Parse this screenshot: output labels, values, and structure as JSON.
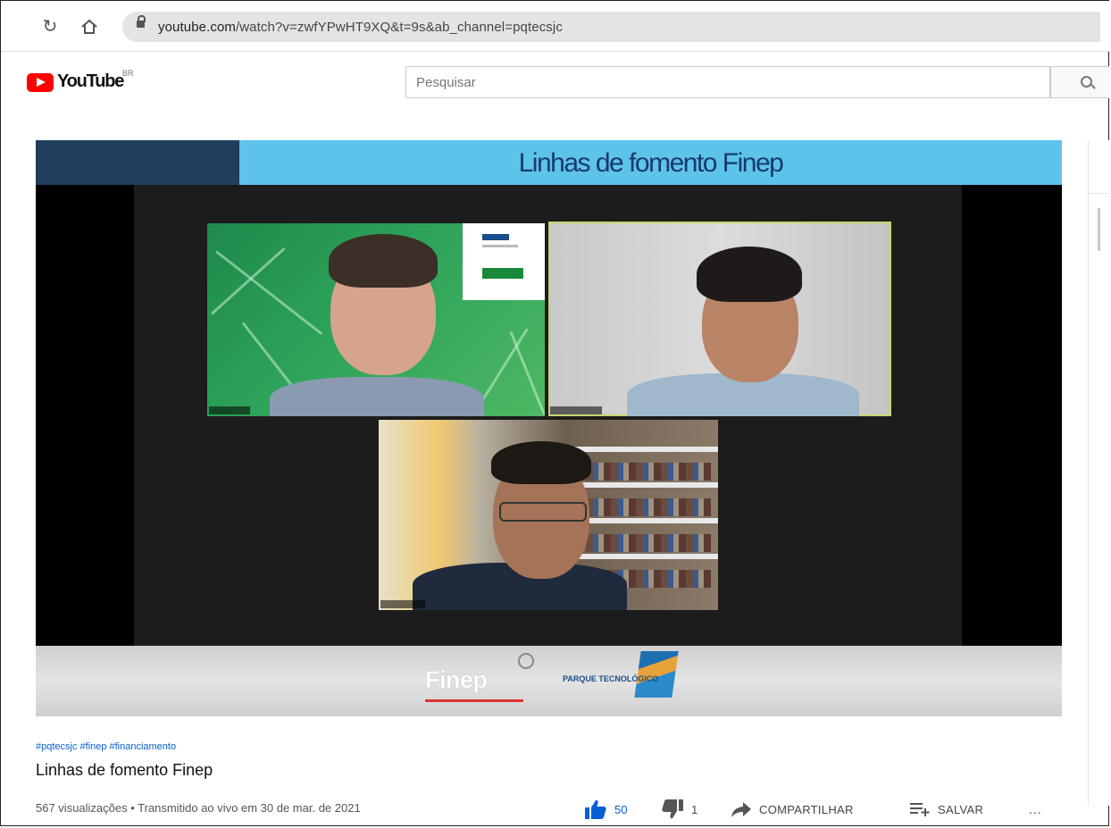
{
  "browser": {
    "url_domain": "youtube.com",
    "url_path": "/watch?v=zwfYPwHT9XQ&t=9s&ab_channel=pqtecsjc"
  },
  "youtube": {
    "logo_text": "YouTube",
    "logo_country": "BR",
    "search_placeholder": "Pesquisar"
  },
  "video_frame": {
    "banner_title": "Linhas de fomento Finep",
    "finep_logo_text": "Finep",
    "parque_logo_text": "PARQUE TECNOLÓGICO"
  },
  "video": {
    "hashtags": [
      "#pqtecsjc",
      "#finep",
      "#financiamento"
    ],
    "title": "Linhas de fomento Finep",
    "meta": "567 visualizações • Transmitido ao vivo em 30 de mar. de 2021",
    "likes": "50",
    "dislikes": "1",
    "share_label": "COMPARTILHAR",
    "save_label": "SALVAR",
    "more_label": "..."
  },
  "colors": {
    "youtube_red": "#ff0000",
    "like_blue": "#065fd4",
    "banner_cyan": "#5ec3ea",
    "banner_navy": "#1f3f5c"
  }
}
